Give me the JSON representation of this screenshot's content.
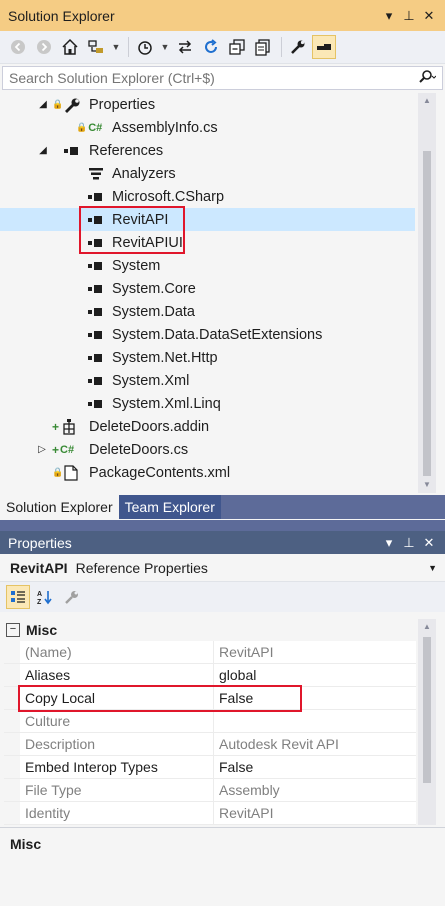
{
  "solution_explorer": {
    "title": "Solution Explorer",
    "controls": {
      "dropdown": "▾",
      "pin": "⊥",
      "close": "✕"
    },
    "toolbar": [
      "back-icon",
      "forward-icon",
      "home-icon",
      "switch-views-icon",
      "pending-changes-icon",
      "sync-icon",
      "refresh-icon",
      "collapse-all-icon",
      "show-all-files-icon",
      "properties-icon",
      "preview-icon"
    ],
    "search_placeholder": "Search Solution Explorer (Ctrl+$)",
    "tree": [
      {
        "label": "Properties",
        "icon": "wrench-icon",
        "expander": "◢",
        "locked": true
      },
      {
        "label": "AssemblyInfo.cs",
        "icon": "csharp-icon",
        "locked": true
      },
      {
        "label": "References",
        "icon": "references-icon",
        "expander": "◢"
      },
      {
        "label": "Analyzers",
        "icon": "analyzers-icon"
      },
      {
        "label": "Microsoft.CSharp",
        "icon": "reference-icon"
      },
      {
        "label": "RevitAPI",
        "icon": "reference-icon",
        "selected": true
      },
      {
        "label": "RevitAPIUI",
        "icon": "reference-icon"
      },
      {
        "label": "System",
        "icon": "reference-icon"
      },
      {
        "label": "System.Core",
        "icon": "reference-icon"
      },
      {
        "label": "System.Data",
        "icon": "reference-icon"
      },
      {
        "label": "System.Data.DataSetExtensions",
        "icon": "reference-icon"
      },
      {
        "label": "System.Net.Http",
        "icon": "reference-icon"
      },
      {
        "label": "System.Xml",
        "icon": "reference-icon"
      },
      {
        "label": "System.Xml.Linq",
        "icon": "reference-icon"
      },
      {
        "label": "DeleteDoors.addin",
        "icon": "addin-file-icon",
        "added": true
      },
      {
        "label": "DeleteDoors.cs",
        "icon": "csharp-icon",
        "expander": "▷",
        "added": true
      },
      {
        "label": "PackageContents.xml",
        "icon": "xml-file-icon",
        "locked": true
      }
    ],
    "tabs": {
      "active": "Solution Explorer",
      "inactive": "Team Explorer"
    }
  },
  "properties": {
    "title": "Properties",
    "controls": {
      "dropdown": "▾",
      "pin": "⊥",
      "close": "✕"
    },
    "object_name": "RevitAPI",
    "object_type": "Reference Properties",
    "category": "Misc",
    "rows": [
      {
        "key": "(Name)",
        "value": "RevitAPI",
        "readonly": true
      },
      {
        "key": "Aliases",
        "value": "global",
        "readonly": false
      },
      {
        "key": "Copy Local",
        "value": "False",
        "readonly": false
      },
      {
        "key": "Culture",
        "value": "",
        "readonly": true
      },
      {
        "key": "Description",
        "value": "Autodesk Revit API",
        "readonly": true
      },
      {
        "key": "Embed Interop Types",
        "value": "False",
        "readonly": false
      },
      {
        "key": "File Type",
        "value": "Assembly",
        "readonly": true
      },
      {
        "key": "Identity",
        "value": "RevitAPI",
        "readonly": true
      }
    ],
    "description_title": "Misc"
  },
  "colors": {
    "active_title": "#f5cc84",
    "inactive_title": "#4d6082",
    "selection": "#cce8ff",
    "highlight_box": "#e0162b"
  }
}
